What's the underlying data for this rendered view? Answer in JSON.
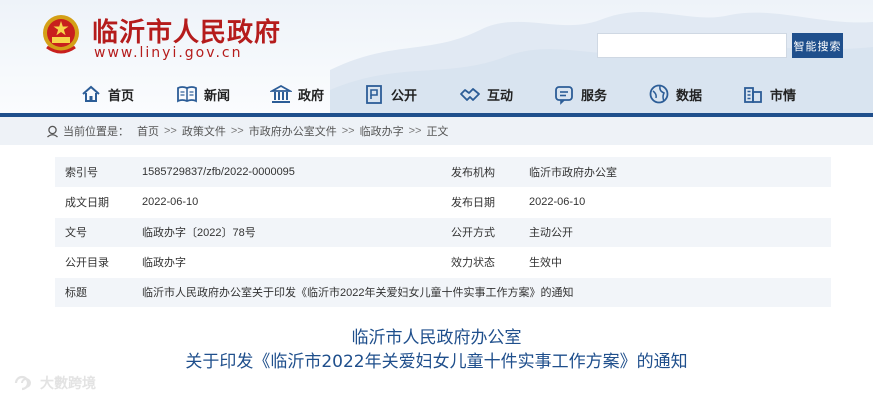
{
  "site": {
    "title": "临沂市人民政府",
    "url": "www.linyi.gov.cn"
  },
  "search": {
    "placeholder": "",
    "button_label": "智能搜索"
  },
  "nav": {
    "items": [
      {
        "label": "首页",
        "icon": "home-icon"
      },
      {
        "label": "新闻",
        "icon": "newspaper-icon"
      },
      {
        "label": "政府",
        "icon": "government-building-icon"
      },
      {
        "label": "公开",
        "icon": "document-icon"
      },
      {
        "label": "互动",
        "icon": "handshake-icon"
      },
      {
        "label": "服务",
        "icon": "service-icon"
      },
      {
        "label": "数据",
        "icon": "globe-icon"
      },
      {
        "label": "市情",
        "icon": "city-icon"
      }
    ]
  },
  "breadcrumb": {
    "prefix": "当前位置是：",
    "items": [
      "首页",
      "政策文件",
      "市政府办公室文件",
      "临政办字",
      "正文"
    ],
    "separator": ">>"
  },
  "meta": {
    "rows": [
      {
        "k1": "索引号",
        "v1": "1585729837/zfb/2022-0000095",
        "k2": "发布机构",
        "v2": "临沂市政府办公室"
      },
      {
        "k1": "成文日期",
        "v1": "2022-06-10",
        "k2": "发布日期",
        "v2": "2022-06-10"
      },
      {
        "k1": "文号",
        "v1": "临政办字〔2022〕78号",
        "k2": "公开方式",
        "v2": "主动公开"
      },
      {
        "k1": "公开目录",
        "v1": "临政办字",
        "k2": "效力状态",
        "v2": "生效中"
      }
    ],
    "title_row": {
      "k": "标题",
      "v": "临沂市人民政府办公室关于印发《临沂市2022年关爱妇女儿童十件实事工作方案》的通知"
    }
  },
  "document": {
    "title_line1": "临沂市人民政府办公室",
    "title_line2": "关于印发《临沂市2022年关爱妇女儿童十件实事工作方案》的通知"
  },
  "watermark": {
    "text": "大數跨境"
  },
  "colors": {
    "brand_red": "#b51c1c",
    "brand_blue": "#1f4f8c",
    "row_tint": "#f2f5f9"
  }
}
